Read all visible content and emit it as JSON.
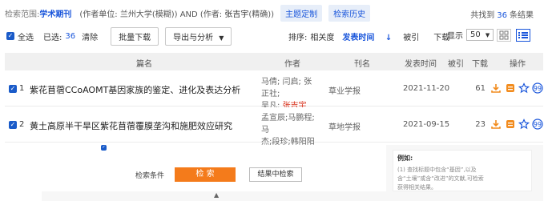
{
  "scope": {
    "label": "检索范围:",
    "value": "学术期刊",
    "query_pre": "(作者单位: 兰州大学(模糊)) AND (作者: ",
    "query_author": "张吉宇",
    "query_post": "(精确))",
    "btn_subject": "主题定制",
    "btn_history": "检索历史"
  },
  "found": {
    "pre": "共找到",
    "count": "36",
    "post": "条结果"
  },
  "toolbar": {
    "select_all": "全选",
    "selected_label": "已选:",
    "selected_count": "36",
    "clear": "清除",
    "batch_download": "批量下载",
    "export_analysis": "导出与分析",
    "sort_label": "排序:",
    "sort_relevance": "相关度",
    "sort_time": "发表时间",
    "sort_cited": "被引",
    "sort_downloads": "下载",
    "show_label": "显示",
    "page_size": "50"
  },
  "table": {
    "headers": {
      "title": "篇名",
      "author": "作者",
      "source": "刊名",
      "date": "发表时间",
      "cited": "被引",
      "downloads": "下载",
      "ops": "操作"
    },
    "rows": [
      {
        "index": "1",
        "title": "紫花苜蓿CCoAOMT基因家族的鉴定、进化及表达分析",
        "authors_line1": "马倩; 闫启; 张正社;",
        "authors_line2_pre": "吴凡; ",
        "authors_line2_hl": "张吉宇",
        "source": "草业学报",
        "date": "2021-11-20",
        "cited": "",
        "downloads": "61"
      },
      {
        "index": "2",
        "title": "黄土高原半干旱区紫花苜蓿覆膜垄沟和施肥效应研究",
        "authors_line1": "孟宣辰;马鹏程;马",
        "authors_line2_pre": "杰;段珍;韩阳阳",
        "authors_line2_hl": "",
        "source": "草地学报",
        "date": "2021-09-15",
        "cited": "",
        "downloads": "23"
      }
    ]
  },
  "lower_panel": {
    "condition_label": "检索条件",
    "search_btn": "检 索",
    "result_search_btn": "结果中检索",
    "example_label": "例如:",
    "example_text_1": "(1) 查找标题中包含“基因”,以及",
    "example_text_2": "含“土壤”或含“改进”的文献,可检索",
    "example_text_3": "获得相关结果。"
  },
  "colors": {
    "accent": "#1a56db",
    "highlight": "#d9301a",
    "download_icon": "#f28c1e",
    "search_btn": "#f47b1b"
  }
}
